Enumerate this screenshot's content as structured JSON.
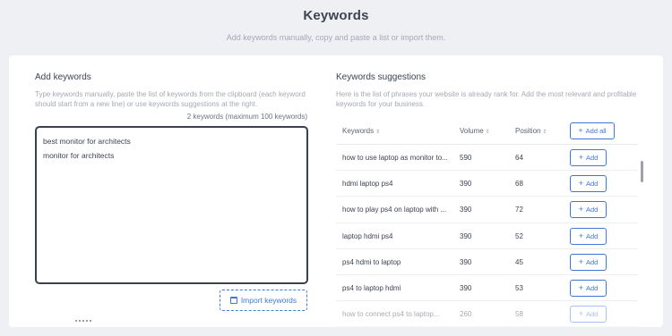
{
  "header": {
    "title": "Keywords",
    "subtitle": "Add keywords manually, copy and paste a list or import them."
  },
  "add_keywords": {
    "title": "Add keywords",
    "help": "Type keywords manually, paste the list of keywords from the clipboard (each keyword should start from a new line) or use keywords suggestions at the right.",
    "count": "2 keywords (maximum 100 keywords)",
    "keywords": [
      "best monitor for architects",
      "monitor for architects"
    ],
    "import_label": "Import keywords"
  },
  "suggestions": {
    "title": "Keywords suggestions",
    "help": "Here is the list of phrases your website is already rank for. Add the most relevant and profitable keywords for your business.",
    "columns": {
      "keyword": "Keywords",
      "volume": "Volume",
      "position": "Position"
    },
    "add_all_label": "Add all",
    "add_label": "Add",
    "rows": [
      {
        "keyword": "how to use laptop as monitor to...",
        "volume": "590",
        "position": "64"
      },
      {
        "keyword": "hdmi laptop ps4",
        "volume": "390",
        "position": "68"
      },
      {
        "keyword": "how to play ps4 on laptop with ...",
        "volume": "390",
        "position": "72"
      },
      {
        "keyword": "laptop hdmi ps4",
        "volume": "390",
        "position": "52"
      },
      {
        "keyword": "ps4 hdmi to laptop",
        "volume": "390",
        "position": "45"
      },
      {
        "keyword": "ps4 to laptop hdmi",
        "volume": "390",
        "position": "53"
      },
      {
        "keyword": "how to connect ps4 to laptop...",
        "volume": "260",
        "position": "58"
      }
    ]
  }
}
